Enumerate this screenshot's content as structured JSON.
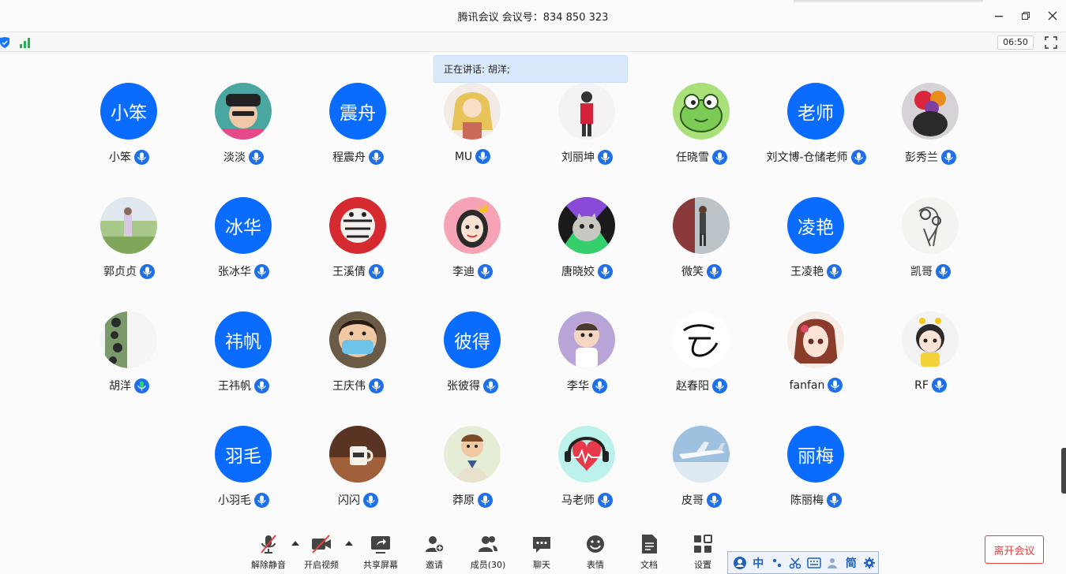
{
  "window": {
    "title": "腾讯会议  会议号：834 850 323",
    "timer": "06:50"
  },
  "speaking": {
    "text": "正在讲话: 胡洋;"
  },
  "participants": [
    {
      "name": "小笨",
      "avatar_text": "小笨"
    },
    {
      "name": "淡淡",
      "avatar_text": ""
    },
    {
      "name": "程震舟",
      "avatar_text": "震舟"
    },
    {
      "name": "MU",
      "avatar_text": ""
    },
    {
      "name": "刘丽坤",
      "avatar_text": ""
    },
    {
      "name": "任晓雪",
      "avatar_text": ""
    },
    {
      "name": "刘文博-仓储老师",
      "avatar_text": "老师"
    },
    {
      "name": "彭秀兰",
      "avatar_text": ""
    },
    {
      "name": "郭贞贞",
      "avatar_text": ""
    },
    {
      "name": "张冰华",
      "avatar_text": "冰华"
    },
    {
      "name": "王溪倩",
      "avatar_text": ""
    },
    {
      "name": "李迪",
      "avatar_text": ""
    },
    {
      "name": "唐晓姣",
      "avatar_text": ""
    },
    {
      "name": "微笑",
      "avatar_text": ""
    },
    {
      "name": "王凌艳",
      "avatar_text": "凌艳"
    },
    {
      "name": "凯哥",
      "avatar_text": ""
    },
    {
      "name": "胡洋",
      "avatar_text": ""
    },
    {
      "name": "王祎帆",
      "avatar_text": "祎帆"
    },
    {
      "name": "王庆伟",
      "avatar_text": ""
    },
    {
      "name": "张彼得",
      "avatar_text": "彼得"
    },
    {
      "name": "李华",
      "avatar_text": ""
    },
    {
      "name": "赵春阳",
      "avatar_text": ""
    },
    {
      "name": "fanfan",
      "avatar_text": ""
    },
    {
      "name": "RF",
      "avatar_text": ""
    },
    {
      "name": "小羽毛",
      "avatar_text": "羽毛"
    },
    {
      "name": "闪闪",
      "avatar_text": ""
    },
    {
      "name": "莽原",
      "avatar_text": ""
    },
    {
      "name": "马老师",
      "avatar_text": ""
    },
    {
      "name": "皮哥",
      "avatar_text": ""
    },
    {
      "name": "陈丽梅",
      "avatar_text": "丽梅"
    }
  ],
  "toolbar": {
    "unmute": "解除静音",
    "start_video": "开启视频",
    "share_screen": "共享屏幕",
    "invite": "邀请",
    "members": "成员(30)",
    "chat": "聊天",
    "reactions": "表情",
    "docs": "文档",
    "settings": "设置"
  },
  "leave_button": "离开会议",
  "ime": {
    "lang": "中",
    "mode": "简"
  },
  "colors": {
    "accent": "#0a6cff",
    "mic": "#1f6fe6",
    "danger": "#e4403f"
  }
}
